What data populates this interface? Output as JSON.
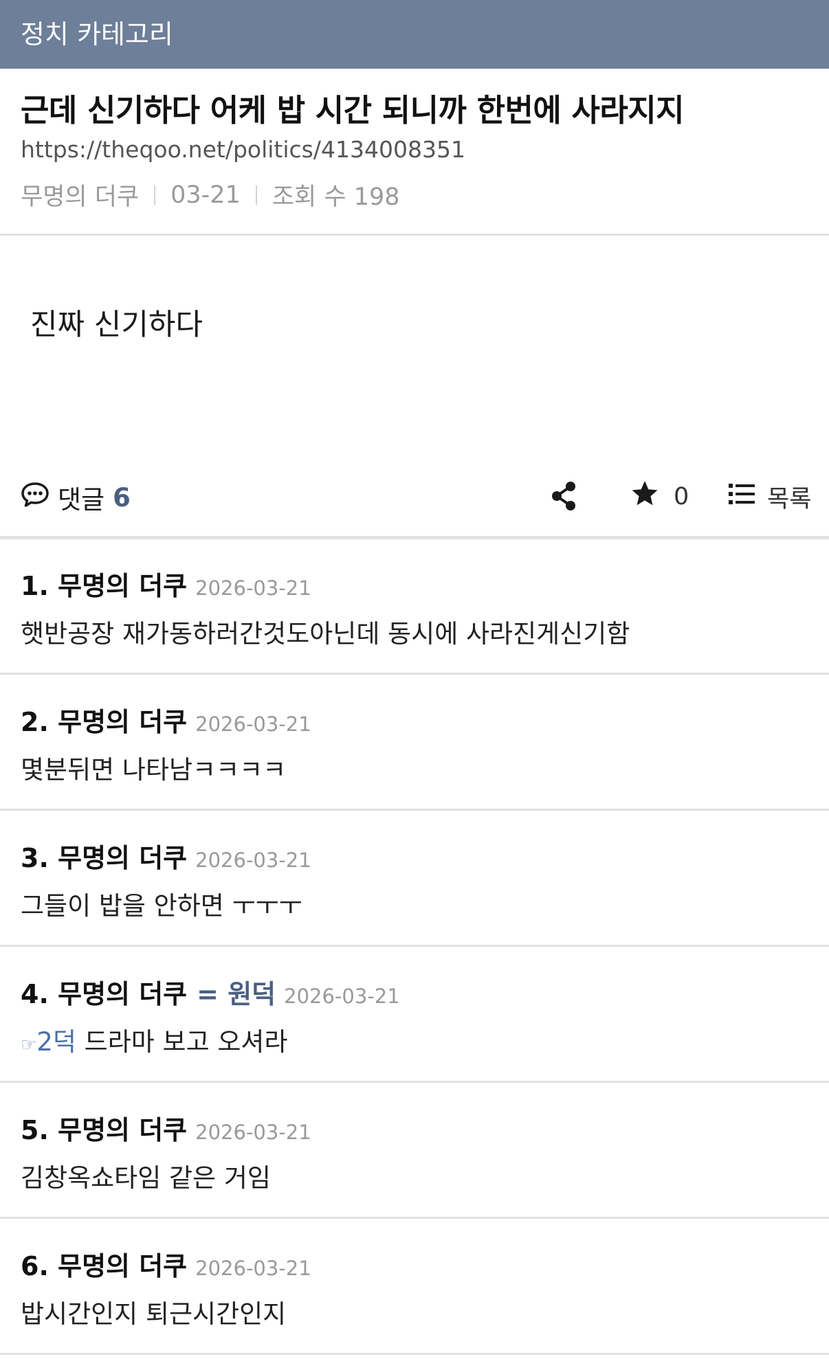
{
  "category": "정치 카테고리",
  "post": {
    "title": "근데 신기하다 어케 밥 시간 되니까 한번에 사라지지",
    "url": "https://theqoo.net/politics/4134008351",
    "author": "무명의 더쿠",
    "date": "03-21",
    "views": "조회 수 198",
    "body": "진짜 신기하다"
  },
  "actions": {
    "comment_label": "댓글",
    "comment_count": "6",
    "star_count": "0",
    "list_label": "목록"
  },
  "comments": [
    {
      "head": "1. 무명의 더쿠",
      "tag": "",
      "date": "2026-03-21",
      "ref": "",
      "text": "햇반공장 재가동하러간것도아닌데 동시에 사라진게신기함"
    },
    {
      "head": "2. 무명의 더쿠",
      "tag": "",
      "date": "2026-03-21",
      "ref": "",
      "text": "몇분뒤면 나타남ㅋㅋㅋㅋ"
    },
    {
      "head": "3. 무명의 더쿠",
      "tag": "",
      "date": "2026-03-21",
      "ref": "",
      "text": "그들이 밥을 안하면 ㅜㅜㅜ"
    },
    {
      "head": "4. 무명의 더쿠",
      "tag": "= 원덕",
      "date": "2026-03-21",
      "ref_icon": "☞",
      "ref": "2덕",
      "text": " 드라마 보고 오셔라"
    },
    {
      "head": "5. 무명의 더쿠",
      "tag": "",
      "date": "2026-03-21",
      "ref": "",
      "text": "김창옥쇼타임 같은 거임"
    },
    {
      "head": "6. 무명의 더쿠",
      "tag": "",
      "date": "2026-03-21",
      "ref": "",
      "text": "밥시간인지 퇴근시간인지"
    }
  ],
  "colors": {
    "category_bar": "#6d7f99",
    "accent": "#4a5f80",
    "meta_gray": "#9a9a9a",
    "divider": "#e2e2e2"
  }
}
